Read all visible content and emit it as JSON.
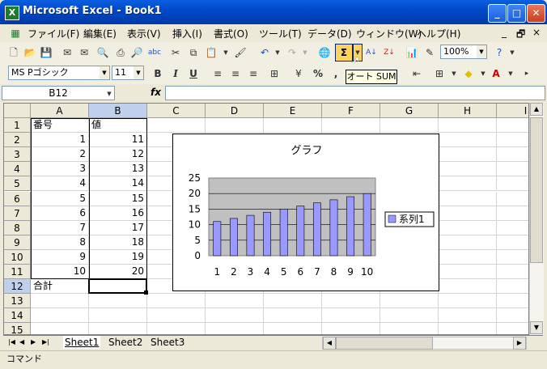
{
  "window": {
    "title": "Microsoft Excel - Book1",
    "icon": "X",
    "minimize_icon": "_",
    "maximize_icon": "□",
    "close_icon": "✕"
  },
  "menu": {
    "items": [
      "ファイル(F)",
      "編集(E)",
      "表示(V)",
      "挿入(I)",
      "書式(O)",
      "ツール(T)",
      "データ(D)",
      "ウィンドウ(W)",
      "ヘルプ(H)"
    ],
    "min_icon": "_",
    "restore_icon": "🗗",
    "close_icon": "×"
  },
  "toolbar1": {
    "zoom": "100%",
    "autosum_symbol": "Σ"
  },
  "toolbar2": {
    "font_name": "MS Pゴシック",
    "font_size": "11",
    "bold": "B",
    "italic": "I",
    "underline": "U",
    "percent": "%",
    "comma": ","
  },
  "tooltip": "オート SUM",
  "formula_bar": {
    "name_box": "B12",
    "fx": "fx",
    "value": ""
  },
  "columns": [
    "A",
    "B",
    "C",
    "D",
    "E",
    "F",
    "G",
    "H",
    "I"
  ],
  "rows": [
    "1",
    "2",
    "3",
    "4",
    "5",
    "6",
    "7",
    "8",
    "9",
    "10",
    "11",
    "12",
    "13",
    "14",
    "15"
  ],
  "cells": {
    "A1": "番号",
    "B1": "値",
    "A2": "1",
    "B2": "11",
    "A3": "2",
    "B3": "12",
    "A4": "3",
    "B4": "13",
    "A5": "4",
    "B5": "14",
    "A6": "5",
    "B6": "15",
    "A7": "6",
    "B7": "16",
    "A8": "7",
    "B8": "17",
    "A9": "8",
    "B9": "18",
    "A10": "9",
    "B10": "19",
    "A11": "10",
    "B11": "20",
    "A12": "合計"
  },
  "sheets": [
    "Sheet1",
    "Sheet2",
    "Sheet3"
  ],
  "active_sheet": "Sheet1",
  "status": "コマンド",
  "colors": {
    "bar_fill": "#9999ff",
    "plot_bg": "#c0c0c0",
    "selection": "#c0d0ec"
  },
  "chart_data": {
    "type": "bar",
    "title": "グラフ",
    "categories": [
      "1",
      "2",
      "3",
      "4",
      "5",
      "6",
      "7",
      "8",
      "9",
      "10"
    ],
    "series": [
      {
        "name": "系列1",
        "values": [
          11,
          12,
          13,
          14,
          15,
          16,
          17,
          18,
          19,
          20
        ]
      }
    ],
    "ylim": [
      0,
      25
    ],
    "yticks": [
      "0",
      "5",
      "10",
      "15",
      "20",
      "25"
    ],
    "grid": true,
    "legend": "right"
  }
}
